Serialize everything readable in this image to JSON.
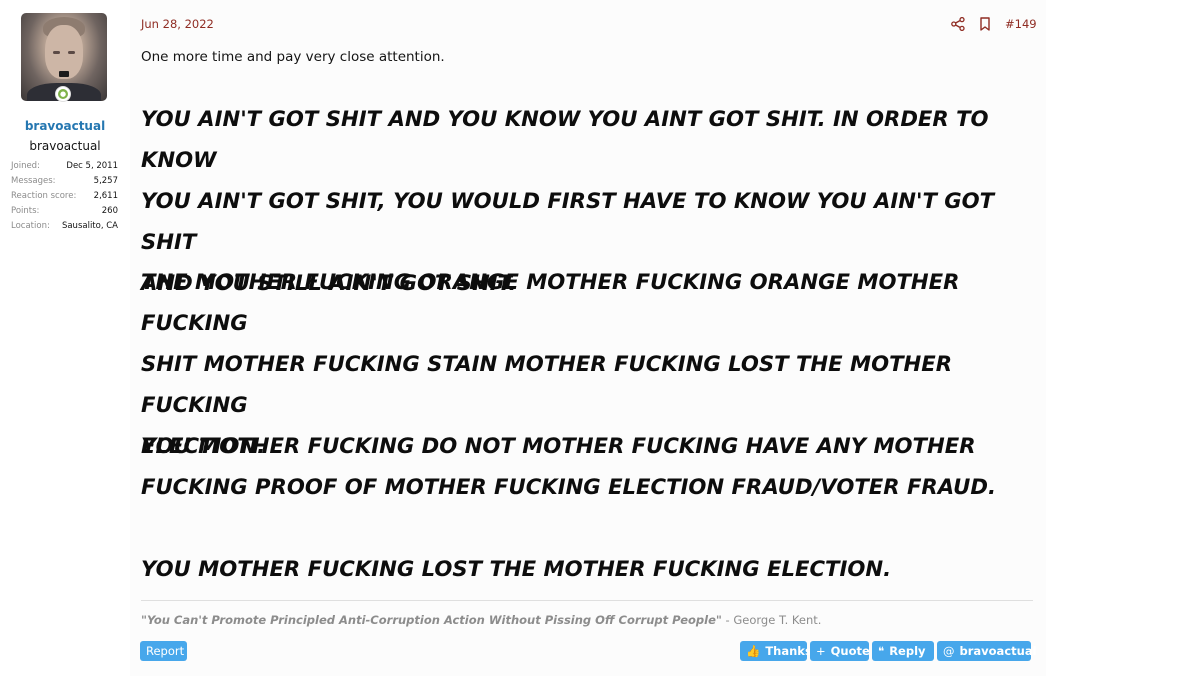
{
  "user": {
    "name": "bravoactual",
    "title": "bravoactual",
    "stats": [
      {
        "label": "Joined:",
        "value": "Dec 5, 2011"
      },
      {
        "label": "Messages:",
        "value": "5,257"
      },
      {
        "label": "Reaction score:",
        "value": "2,611"
      },
      {
        "label": "Points:",
        "value": "260"
      },
      {
        "label": "Location:",
        "value": "Sausalito, CA"
      }
    ]
  },
  "post": {
    "date": "Jun 28, 2022",
    "number": "#149",
    "intro": "One more time and pay very close attention.",
    "paragraphs": [
      "YOU AIN'T GOT SHIT AND YOU KNOW YOU AINT GOT SHIT. IN ORDER TO KNOW\nYOU AIN'T GOT SHIT, YOU WOULD FIRST HAVE TO KNOW YOU AIN'T GOT SHIT\nAND YOU STILL AIN'T GOT SHIT.",
      "THE MOTHER FUCKING ORANGE MOTHER FUCKING ORANGE MOTHER FUCKING\nSHIT MOTHER FUCKING STAIN MOTHER FUCKING LOST THE MOTHER FUCKING\nELECTION.",
      "YOU MOTHER FUCKING DO NOT MOTHER FUCKING HAVE ANY MOTHER\nFUCKING PROOF OF MOTHER FUCKING ELECTION FRAUD/VOTER FRAUD.",
      "YOU MOTHER FUCKING LOST THE MOTHER FUCKING ELECTION."
    ]
  },
  "signature": {
    "quote": "\"You Can't Promote Principled Anti-Corruption Action Without Pissing Off Corrupt People\"",
    "author": " - George T. Kent."
  },
  "actions": {
    "report": "Report",
    "thanks": "Thanks",
    "quote": "Quote",
    "reply": "Reply",
    "mention": "bravoactual"
  },
  "icons": {
    "online": "online-person-icon",
    "share": "share-icon",
    "bookmark": "bookmark-icon",
    "thanks": "thumbs-up-icon",
    "quote": "plus-icon",
    "reply": "quote-marks-icon",
    "mention": "at-icon"
  },
  "colors": {
    "link": "#2577b1",
    "date": "#8f2c23",
    "button": "#47a7eb",
    "online": "#7fb24a"
  }
}
